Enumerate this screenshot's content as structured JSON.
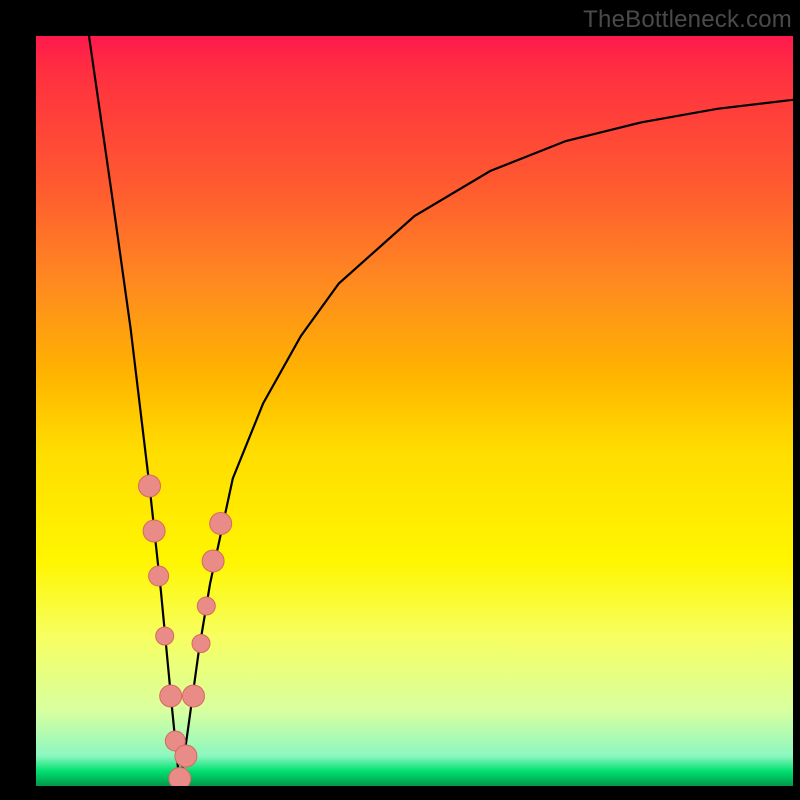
{
  "watermark": "TheBottleneck.com",
  "colors": {
    "bead_fill": "#e98b86",
    "bead_stroke": "#d6695f",
    "curve": "#000000"
  },
  "chart_data": {
    "type": "line",
    "title": "",
    "xlabel": "",
    "ylabel": "",
    "xlim": [
      0,
      100
    ],
    "ylim": [
      0,
      100
    ],
    "grid": false,
    "legend": false,
    "notes": "V-shaped bottleneck curve over rainbow gradient. Approximate x≈ratio(%), y≈bottleneck(%). Minimum near x≈19, y≈0. Values estimated from pixels.",
    "series": [
      {
        "name": "bottleneck-curve",
        "x": [
          7,
          10,
          12.5,
          15,
          16.5,
          18,
          19,
          20,
          21.5,
          23,
          26,
          30,
          35,
          40,
          50,
          60,
          70,
          80,
          90,
          100
        ],
        "y": [
          100,
          79,
          61,
          40,
          26,
          10,
          0,
          7,
          18,
          27,
          41,
          51,
          60,
          67,
          76,
          82,
          86,
          88.5,
          90.3,
          91.5
        ]
      }
    ],
    "markers": [
      {
        "x": 15.0,
        "y": 40,
        "r": 11
      },
      {
        "x": 15.6,
        "y": 34,
        "r": 11
      },
      {
        "x": 16.2,
        "y": 28,
        "r": 10
      },
      {
        "x": 17.0,
        "y": 20,
        "r": 9
      },
      {
        "x": 17.8,
        "y": 12,
        "r": 11
      },
      {
        "x": 18.4,
        "y": 6,
        "r": 10
      },
      {
        "x": 19.0,
        "y": 1,
        "r": 11
      },
      {
        "x": 19.8,
        "y": 4,
        "r": 11
      },
      {
        "x": 20.8,
        "y": 12,
        "r": 11
      },
      {
        "x": 21.8,
        "y": 19,
        "r": 9
      },
      {
        "x": 22.5,
        "y": 24,
        "r": 9
      },
      {
        "x": 23.4,
        "y": 30,
        "r": 11
      },
      {
        "x": 24.4,
        "y": 35,
        "r": 11
      }
    ]
  }
}
